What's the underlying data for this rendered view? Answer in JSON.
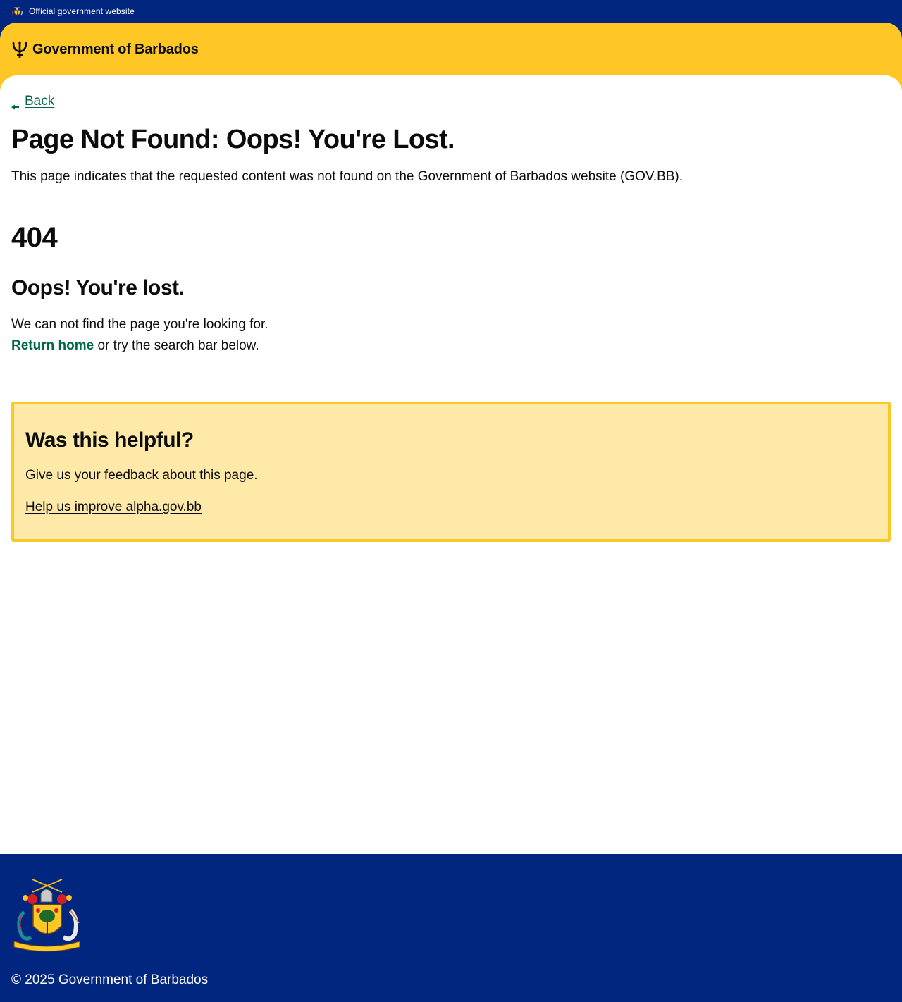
{
  "official_bar": {
    "label": "Official government website",
    "crest_icon": "coat-of-arms-icon"
  },
  "header": {
    "brand_name": "Government of Barbados",
    "logo_icon": "trident-icon",
    "background_color": "#ffc726"
  },
  "main": {
    "back_label": "Back",
    "title": "Page Not Found: Oops! You're Lost.",
    "lead": "This page indicates that the requested content was not found on the Government of Barbados website (GOV.BB).",
    "error_code": "404",
    "oops_heading": "Oops! You're lost.",
    "not_found_text": "We can not find the page you're looking for.",
    "return_home_label": "Return home",
    "return_suffix": " or try the search bar below.",
    "link_color": "#00654a"
  },
  "feedback": {
    "title": "Was this helpful?",
    "text": "Give us your feedback about this page.",
    "link_label": "Help us improve alpha.gov.bb",
    "background_color": "#ffe9a8",
    "border_color": "#ffc726"
  },
  "footer": {
    "copyright": "© 2025 Government of Barbados",
    "logo_icon": "coat-of-arms-icon",
    "background_color": "#00267f"
  }
}
